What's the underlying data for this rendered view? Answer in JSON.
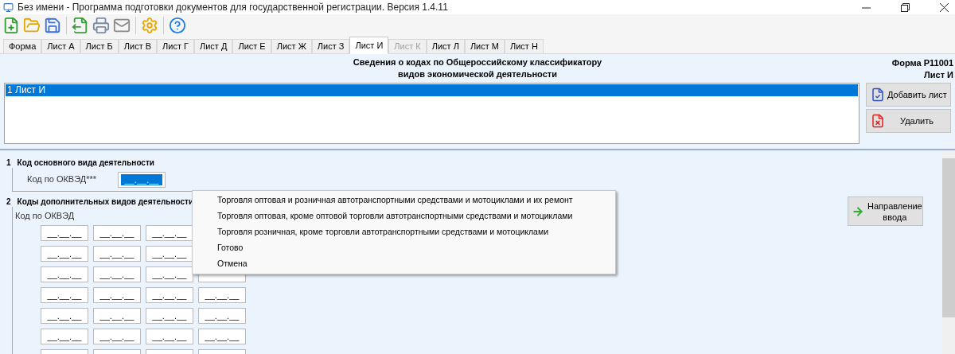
{
  "window": {
    "title": "Без имени - Программа подготовки документов для государственной регистрации. Версия 1.4.11"
  },
  "tabs": [
    {
      "label": "Форма",
      "selected": false,
      "disabled": false
    },
    {
      "label": "Лист А",
      "selected": false,
      "disabled": false
    },
    {
      "label": "Лист Б",
      "selected": false,
      "disabled": false
    },
    {
      "label": "Лист В",
      "selected": false,
      "disabled": false
    },
    {
      "label": "Лист Г",
      "selected": false,
      "disabled": false
    },
    {
      "label": "Лист Д",
      "selected": false,
      "disabled": false
    },
    {
      "label": "Лист Е",
      "selected": false,
      "disabled": false
    },
    {
      "label": "Лист Ж",
      "selected": false,
      "disabled": false
    },
    {
      "label": "Лист З",
      "selected": false,
      "disabled": false
    },
    {
      "label": "Лист И",
      "selected": true,
      "disabled": false
    },
    {
      "label": "Лист К",
      "selected": false,
      "disabled": true
    },
    {
      "label": "Лист Л",
      "selected": false,
      "disabled": false
    },
    {
      "label": "Лист М",
      "selected": false,
      "disabled": false
    },
    {
      "label": "Лист Н",
      "selected": false,
      "disabled": false
    }
  ],
  "header": {
    "title_lines": [
      "Сведения о кодах по Общероссийскому классификатору",
      "видов экономической деятельности"
    ],
    "form_lines": [
      "Форма Р11001",
      "Лист И"
    ]
  },
  "sheet_list": {
    "items": [
      {
        "label": "1 Лист И",
        "selected": true
      }
    ]
  },
  "side_buttons": [
    "Добавить лист",
    "Удалить"
  ],
  "section1": {
    "number": "1",
    "title": "Код основного вида деятельности",
    "label": "Код по ОКВЭД***",
    "field": {
      "value": "__.__.__",
      "selected": true
    }
  },
  "section2": {
    "number": "2",
    "title": "Коды дополнительных видов деятельности",
    "label": "Код по ОКВЭД",
    "rows": [
      [
        "__.__.__",
        "__.__.__",
        "__.__.__"
      ],
      [
        "__.__.__",
        "__.__.__",
        "__.__.__"
      ],
      [
        "__.__.__",
        "__.__.__",
        "__.__.__"
      ],
      [
        "__.__.__",
        "__.__.__",
        "__.__.__",
        "__.__.__"
      ],
      [
        "__.__.__",
        "__.__.__",
        "__.__.__",
        "__.__.__"
      ],
      [
        "__.__.__",
        "__.__.__",
        "__.__.__",
        "__.__.__"
      ]
    ]
  },
  "direction_button": {
    "lines": [
      "Направление",
      "ввода"
    ]
  },
  "context_menu": {
    "items": [
      "Торговля оптовая и розничная автотранспортными средствами и мотоциклами и их ремонт",
      "Торговля оптовая, кроме оптовой торговли автотранспортными средствами и мотоциклами",
      "Торговля розничная, кроме торговли автотранспортными средствами и мотоциклами",
      "Готово",
      "Отмена"
    ]
  }
}
